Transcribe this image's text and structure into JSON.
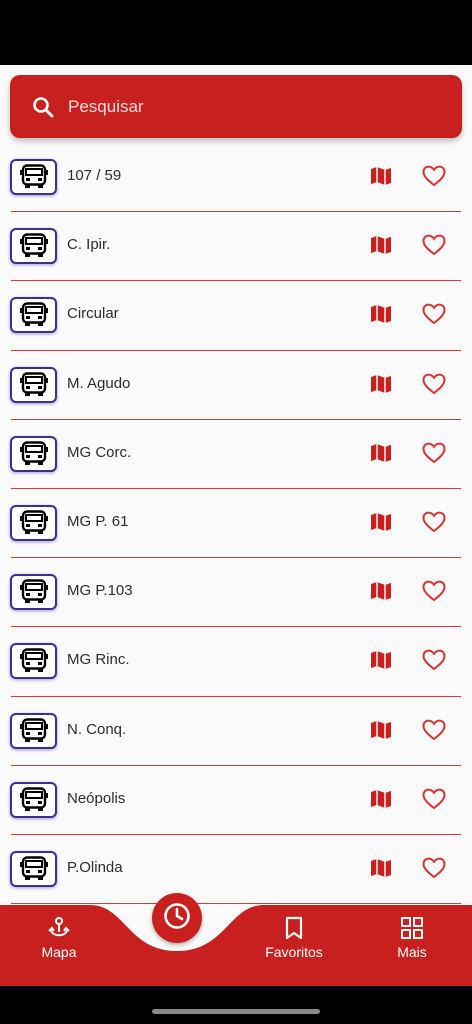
{
  "search": {
    "placeholder": "Pesquisar",
    "icon": "search-icon"
  },
  "routes": [
    {
      "name": "107 / 59"
    },
    {
      "name": "C. Ipir."
    },
    {
      "name": "Circular"
    },
    {
      "name": "M. Agudo"
    },
    {
      "name": "MG Corc."
    },
    {
      "name": "MG P. 61"
    },
    {
      "name": "MG P.103"
    },
    {
      "name": "MG Rinc."
    },
    {
      "name": "N. Conq."
    },
    {
      "name": "Neópolis"
    },
    {
      "name": "P.Olinda"
    }
  ],
  "nav": {
    "map_label": "Mapa",
    "favorites_label": "Favoritos",
    "more_label": "Mais"
  },
  "colors": {
    "accent": "#c8201f",
    "bus_border": "#3b2f8f",
    "divider": "#d33a3a"
  }
}
